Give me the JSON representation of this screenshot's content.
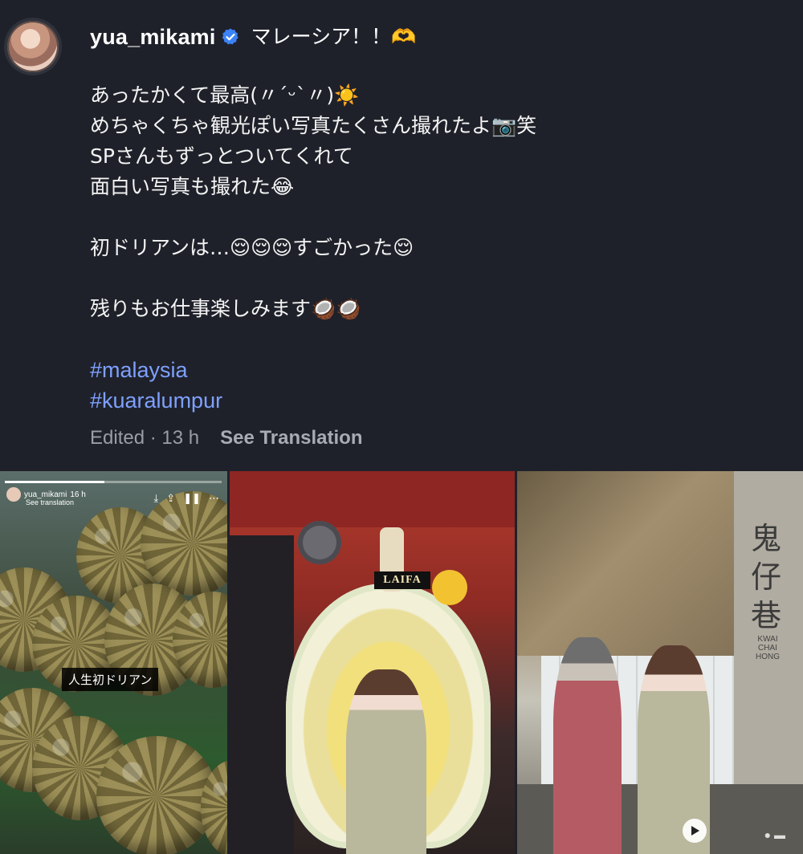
{
  "post": {
    "username": "yua_mikami",
    "caption_head": "マレーシア！！🫶",
    "lines": [
      "あったかくて最高(〃ˊᵕˋ〃)☀️",
      "めちゃくちゃ観光ぽい写真たくさん撮れたよ📷笑",
      "SPさんもずっとついてくれて",
      "面白い写真も撮れた😂",
      "",
      "初ドリアンは…😌😌😌すごかった😌",
      "",
      "残りもお仕事楽しみます🥥🥥",
      ""
    ],
    "hashtags": [
      "#malaysia",
      "#kuaralumpur"
    ],
    "meta": {
      "edited": "Edited · 13 h",
      "see_translation": "See Translation"
    }
  },
  "media": {
    "photo1": {
      "story_user": "yua_mikami",
      "story_time": "16 h",
      "story_translate": "See translation",
      "sticker": "人生初ドリアン"
    },
    "photo2": {
      "sign": "LAIFA"
    },
    "photo3": {
      "sign_chars": [
        "鬼",
        "仔",
        "巷"
      ],
      "sign_en": "KWAI CHAI HONG"
    }
  },
  "colors": {
    "background": "#1f212a",
    "hashtag": "#7ea1ff",
    "verified": "#3b82f6",
    "meta": "#9a9ca6"
  }
}
